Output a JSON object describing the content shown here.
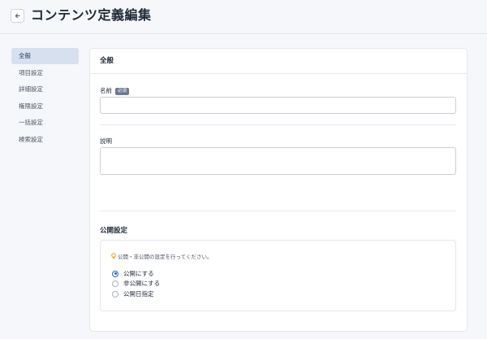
{
  "header": {
    "title": "コンテンツ定義編集",
    "back_icon": "arrow-left-icon"
  },
  "sidebar": {
    "items": [
      {
        "label": "全般",
        "active": true
      },
      {
        "label": "項目設定",
        "active": false
      },
      {
        "label": "詳細設定",
        "active": false
      },
      {
        "label": "権限設定",
        "active": false
      },
      {
        "label": "一括設定",
        "active": false
      },
      {
        "label": "検索設定",
        "active": false
      }
    ]
  },
  "card": {
    "title": "全般",
    "name_field": {
      "label": "名前",
      "required_badge": "必須",
      "value": ""
    },
    "description_field": {
      "label": "説明",
      "value": ""
    },
    "publish": {
      "title": "公開設定",
      "hint": "公開・非公開の設定を行ってください。",
      "hint_icon": "bulb-icon",
      "options": [
        {
          "label": "公開にする",
          "checked": true
        },
        {
          "label": "非公開にする",
          "checked": false
        },
        {
          "label": "公開日指定",
          "checked": false
        }
      ]
    }
  },
  "colors": {
    "accent": "#2563c9",
    "sidebar_active_bg": "#d6e0ef",
    "badge_bg": "#6b7a90",
    "hint_icon": "#f59e0b"
  }
}
